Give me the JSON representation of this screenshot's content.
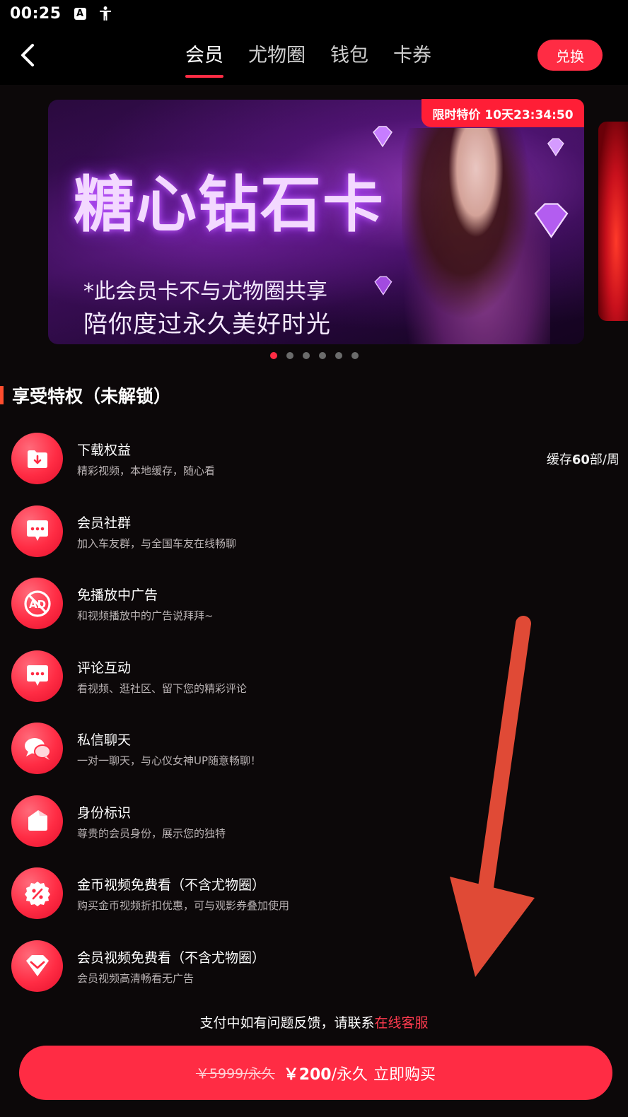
{
  "status_bar": {
    "time": "00:25",
    "a_icon": "A"
  },
  "nav": {
    "tabs": [
      {
        "label": "会员",
        "active": true
      },
      {
        "label": "尤物圈",
        "active": false
      },
      {
        "label": "钱包",
        "active": false
      },
      {
        "label": "卡券",
        "active": false
      }
    ],
    "exchange_label": "兑换"
  },
  "banner": {
    "title": "糖心钻石卡",
    "line1": "*此会员卡不与尤物圈共享",
    "line2": "陪你度过永久美好时光",
    "limit_tag": "限时特价 10天23:34:50",
    "dots_count": 6,
    "active_dot": 0
  },
  "section": {
    "title": "享受特权（未解锁）"
  },
  "features": [
    {
      "icon": "download-folder-icon",
      "title": "下载权益",
      "desc": "精彩视频，本地缓存，随心看",
      "right_prefix": "缓存",
      "right_value": "60",
      "right_suffix": "部/周"
    },
    {
      "icon": "chat-bubble-icon",
      "title": "会员社群",
      "desc": "加入车友群，与全国车友在线畅聊"
    },
    {
      "icon": "no-ad-icon",
      "title": "免播放中广告",
      "desc": "和视频播放中的广告说拜拜~"
    },
    {
      "icon": "comment-icon",
      "title": "评论互动",
      "desc": "看视频、逛社区、留下您的精彩评论"
    },
    {
      "icon": "private-message-icon",
      "title": "私信聊天",
      "desc": "一对一聊天，与心仪女神UP随意畅聊！"
    },
    {
      "icon": "identity-badge-icon",
      "title": "身份标识",
      "desc": "尊贵的会员身份，展示您的独特"
    },
    {
      "icon": "coin-discount-icon",
      "title": "金币视频免费看（不含尤物圈）",
      "desc": "购买金币视频折扣优惠，可与观影券叠加使用"
    },
    {
      "icon": "diamond-icon",
      "title": "会员视频免费看（不含尤物圈）",
      "desc": "会员视频高清畅看无广告"
    }
  ],
  "footer": {
    "help_text": "支付中如有问题反馈，请联系",
    "help_link": "在线客服",
    "old_price": "￥5999/永久",
    "price": "￥200",
    "unit": "/永久",
    "action": "立即购买"
  },
  "colors": {
    "accent": "#ff2c44",
    "background": "#0c0809",
    "arrow": "#e04a36"
  }
}
